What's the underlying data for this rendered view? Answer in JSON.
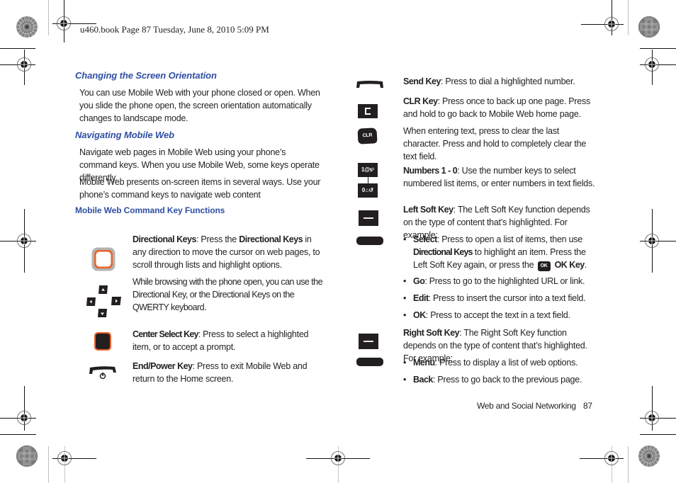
{
  "slug": "u460.book  Page 87  Tuesday, June 8, 2010  5:09 PM",
  "left": {
    "sections": [
      {
        "heading": "Changing the Screen Orientation",
        "paragraphs": [
          "You can use Mobile Web with your phone closed or open. When you slide the phone open, the screen orientation automatically changes to landscape mode."
        ]
      },
      {
        "heading": "Navigating Mobile Web",
        "paragraphs": [
          "Navigate web pages in Mobile Web using your phone’s command keys. When you use Mobile Web, some keys operate differently.",
          "Mobile Web presents on-screen items in several ways. Use your phone’s command keys to navigate web content"
        ]
      }
    ],
    "subheading": "Mobile Web Command Key Functions",
    "keys": [
      {
        "icon": "directional-ring-icon",
        "term": "Directional Keys",
        "text_a": ": Press the ",
        "term2": "Directional Keys",
        "text_b": " in any direction to move the cursor on web pages, to scroll through lists and highlight options."
      },
      {
        "icon": "qwerty-arrow-keys-icon",
        "text": "While browsing with the phone open, you can use the Directional Key, or the Directional Keys on the QWERTY keyboard."
      },
      {
        "icon": "center-select-key-icon",
        "term": "Center Select Key",
        "text": ": Press to select a highlighted item, or to accept a prompt."
      },
      {
        "icon": "end-power-key-icon",
        "term": "End/Power Key",
        "text": ": Press to exit Mobile Web and return to the Home screen."
      }
    ]
  },
  "right": {
    "keys": [
      {
        "icon": "send-key-icon",
        "term": "Send Key",
        "text": ": Press to dial a highlighted number."
      },
      {
        "icon": "c-key-icon",
        "term": "CLR Key",
        "text": ": Press once to back up one page. Press and hold to go back to Mobile Web home page."
      },
      {
        "icon": "clr-key-icon",
        "text": "When entering text, press to clear the last character. Press and hold to completely clear the text field."
      },
      {
        "icon": "number-keys-icon",
        "term": "Numbers 1 - 0",
        "text": ": Use the number keys to select numbered list items, or enter numbers in text fields.",
        "key_top_label": "1@ꜱ¹",
        "key_bottom_label": "0⌂↺"
      },
      {
        "icon": "left-soft-key-icon",
        "term": "Left Soft Key",
        "text": ": The Left Soft Key function depends on the type of content that’s highlighted. For example:",
        "bullets": [
          {
            "term": "Select",
            "text_a": ": Press to open a list of items, then use ",
            "term2": "Directional Keys",
            "text_b": " to highlight an item. Press the Left Soft Key again, or press the ",
            "ok_icon_label": "OK",
            "term3": "OK Key",
            "text_c": "."
          },
          {
            "term": "Go",
            "text": ": Press to go to the highlighted URL or link."
          },
          {
            "term": "Edit",
            "text": ": Press to insert the cursor into a text field."
          },
          {
            "term": "OK",
            "text": ": Press to accept the text in a text field."
          }
        ]
      },
      {
        "icon": "right-soft-key-icon",
        "term": "Right Soft Key",
        "text": ": The Right Soft Key function depends on the type of content that’s highlighted. For example:",
        "bullets": [
          {
            "term": "Menu",
            "text": ": Press to display a list of web options."
          },
          {
            "term": "Back",
            "text": ": Press to go back to the previous page."
          }
        ]
      }
    ],
    "clr_label": "CLR"
  },
  "footer": {
    "section": "Web and Social Networking",
    "page": "87"
  },
  "colors": {
    "heading_blue": "#2e4fa3",
    "key_orange": "#e8632a",
    "key_black": "#231f20"
  }
}
